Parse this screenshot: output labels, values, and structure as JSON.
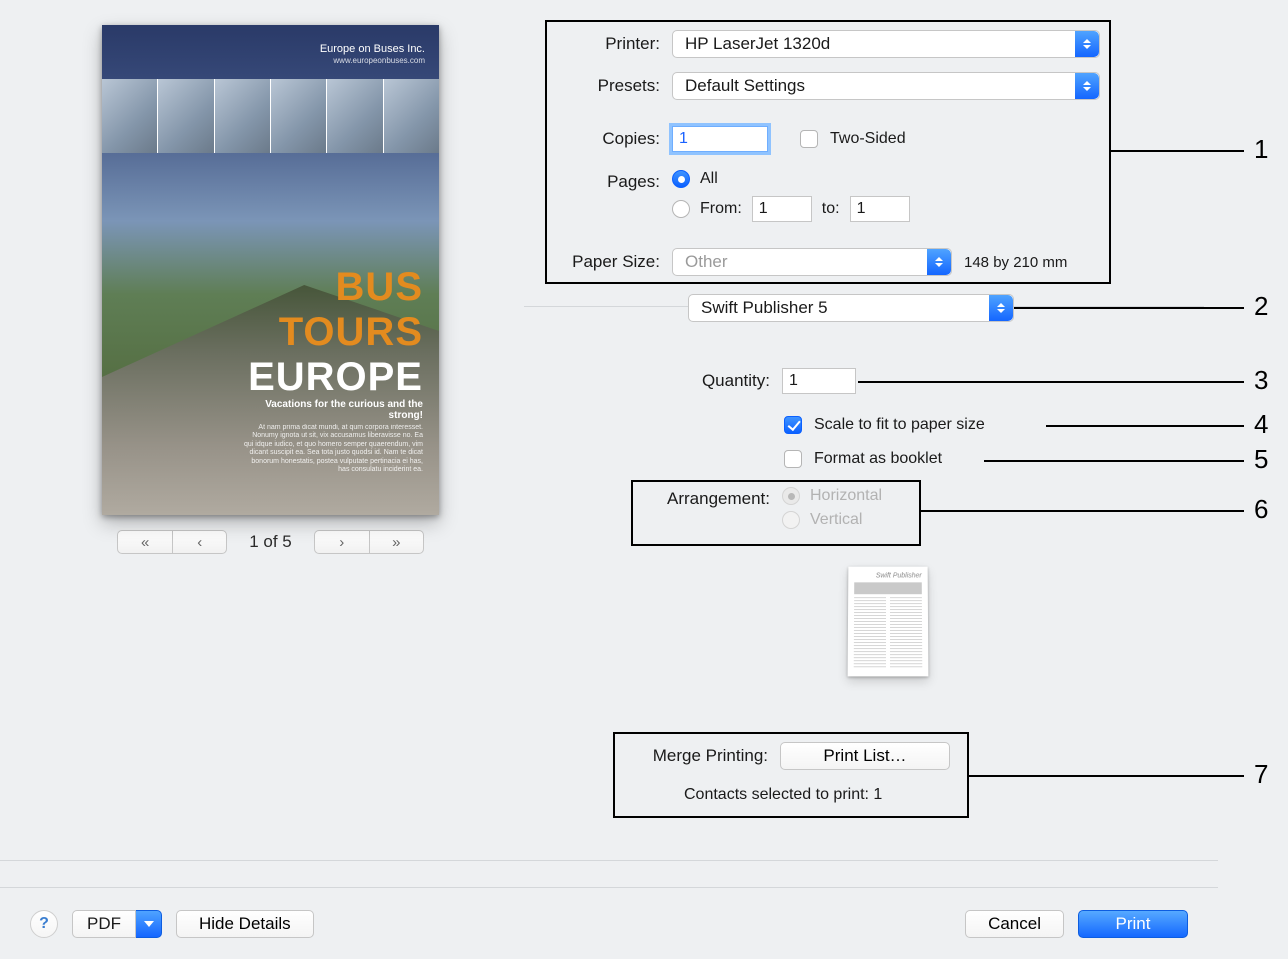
{
  "preview": {
    "company": "Europe on Buses Inc.",
    "company_sub": "www.europeonbuses.com",
    "title_line1": "BUS",
    "title_line2": "TOURS",
    "title_line3": "EUROPE",
    "tagline": "Vacations for the curious and the strong!",
    "blurb": "At nam prima dicat mundi, at qum corpora interesset. Nonumy ignota ut sit, vix accusamus liberavisse no. Ea qui idque iudico, et quo homero semper quaerendum, vim dicant suscipit ea. Sea tota justo quodsi id. Nam te dicat bonorum honestatis, postea vulputate pertinacia ei has, has consulatu inciderint ea."
  },
  "pager": {
    "first": "«",
    "prev": "‹",
    "indicator": "1 of 5",
    "next": "›",
    "last": "»"
  },
  "labels": {
    "printer": "Printer:",
    "presets": "Presets:",
    "copies": "Copies:",
    "two_sided": "Two-Sided",
    "pages": "Pages:",
    "all": "All",
    "from": "From:",
    "to": "to:",
    "paper_size": "Paper Size:",
    "quantity": "Quantity:",
    "scale_fit": "Scale to fit to paper size",
    "format_booklet": "Format as booklet",
    "arrangement": "Arrangement:",
    "horizontal": "Horizontal",
    "vertical": "Vertical",
    "merge_printing": "Merge Printing:",
    "contacts_selected": "Contacts selected to print: 1",
    "thumb_title": "Swift Publisher"
  },
  "values": {
    "printer": "HP LaserJet 1320d",
    "presets": "Default Settings",
    "copies": "1",
    "pages_from": "1",
    "pages_to": "1",
    "paper_size": "Other",
    "paper_dim": "148 by 210 mm",
    "app_popup": "Swift Publisher 5",
    "quantity": "1",
    "print_list": "Print List…"
  },
  "buttons": {
    "help": "?",
    "pdf": "PDF",
    "hide_details": "Hide Details",
    "cancel": "Cancel",
    "print": "Print"
  },
  "callouts": {
    "1": "1",
    "2": "2",
    "3": "3",
    "4": "4",
    "5": "5",
    "6": "6",
    "7": "7"
  }
}
